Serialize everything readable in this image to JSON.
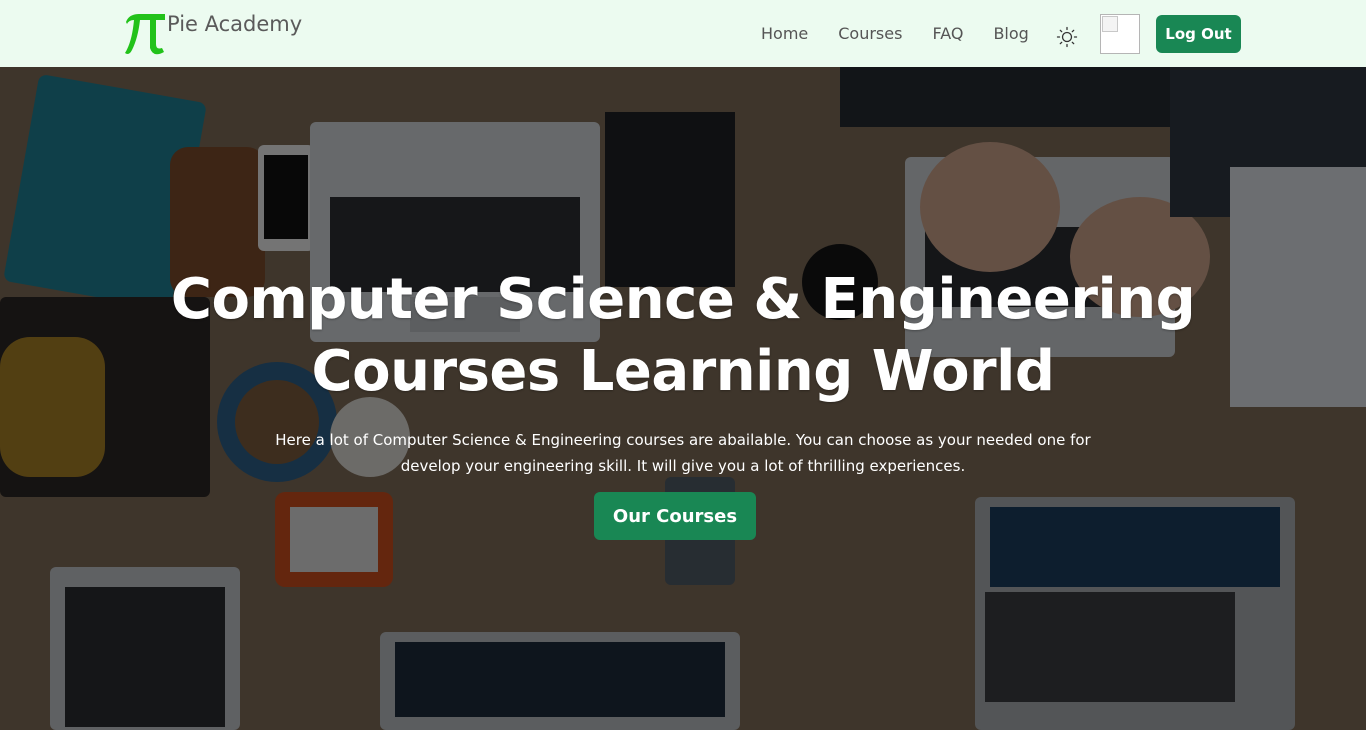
{
  "brand": {
    "logo_symbol": "π",
    "name": "Pie Academy",
    "logo_color": "#22c21a"
  },
  "nav": {
    "links": [
      {
        "label": "Home"
      },
      {
        "label": "Courses"
      },
      {
        "label": "FAQ"
      },
      {
        "label": "Blog"
      }
    ],
    "theme_toggle_icon": "sun-icon",
    "logout_label": "Log Out"
  },
  "hero": {
    "title_line1": "Computer Science & Engineering",
    "title_line2": "Courses Learning World",
    "description_line1": "Here a lot of Computer Science & Engineering courses are abailable. You can choose as your needed one for",
    "description_line2": "develop your engineering skill. It will give you a lot of thrilling experiences.",
    "cta_label": "Our Courses",
    "background_image": "overhead view of desk with laptops, notebooks, phones and coffee"
  },
  "colors": {
    "navbar_bg": "#ecfbf0",
    "primary": "#198754",
    "text_muted": "#555555"
  }
}
